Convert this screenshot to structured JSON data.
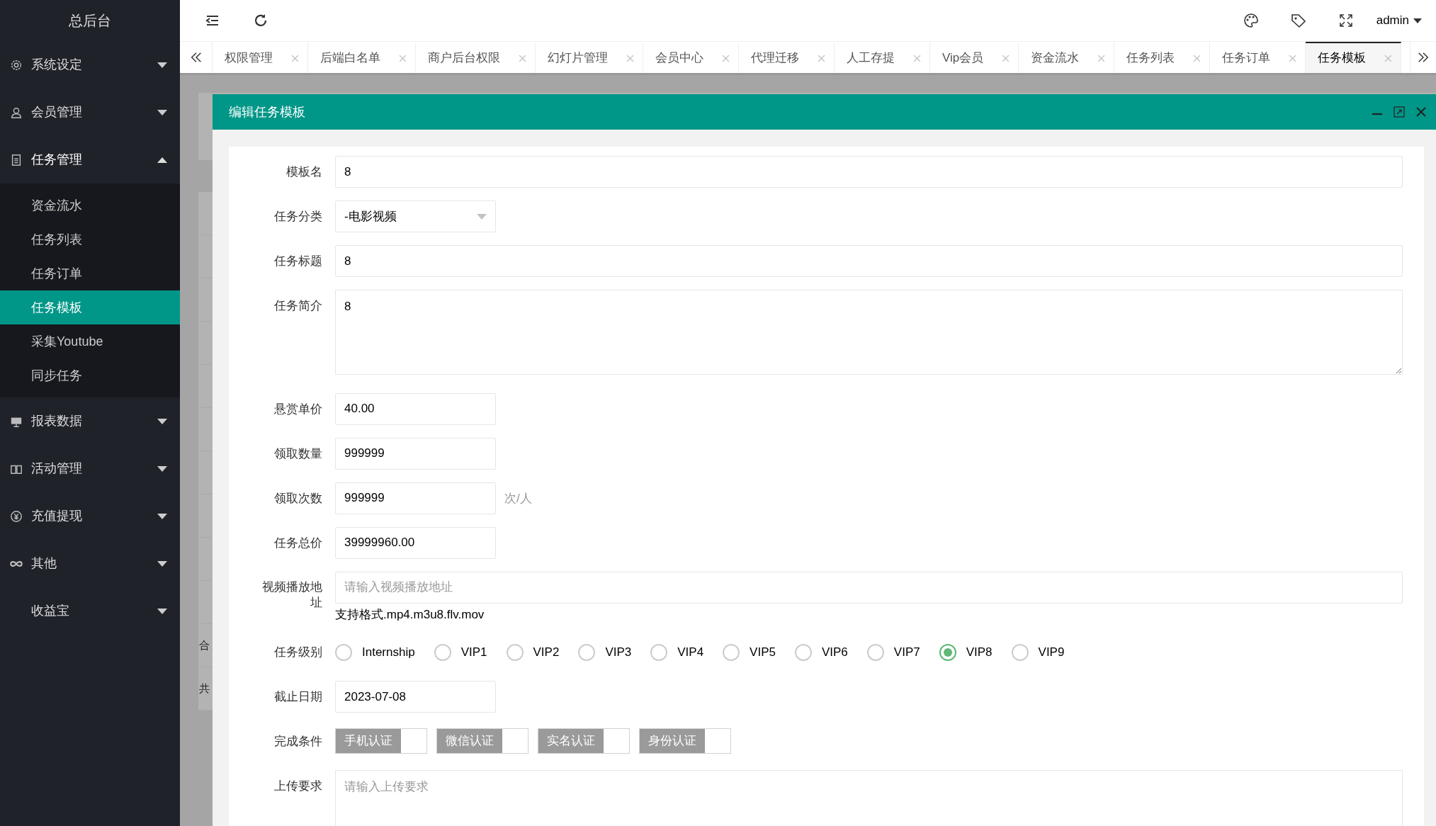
{
  "sidebar": {
    "title": "总后台",
    "menus": [
      {
        "label": "系统设定",
        "expanded": false
      },
      {
        "label": "会员管理",
        "expanded": false
      },
      {
        "label": "任务管理",
        "expanded": true,
        "children": [
          {
            "label": "资金流水",
            "selected": false
          },
          {
            "label": "任务列表",
            "selected": false
          },
          {
            "label": "任务订单",
            "selected": false
          },
          {
            "label": "任务模板",
            "selected": true
          },
          {
            "label": "采集Youtube",
            "selected": false
          },
          {
            "label": "同步任务",
            "selected": false
          }
        ]
      },
      {
        "label": "报表数据",
        "expanded": false
      },
      {
        "label": "活动管理",
        "expanded": false
      },
      {
        "label": "充值提现",
        "expanded": false
      },
      {
        "label": "其他",
        "expanded": false
      },
      {
        "label": "收益宝",
        "expanded": false
      }
    ]
  },
  "header": {
    "user": "admin"
  },
  "tabs": [
    {
      "label": "权限管理",
      "selected": false
    },
    {
      "label": "后端白名单",
      "selected": false
    },
    {
      "label": "商户后台权限",
      "selected": false
    },
    {
      "label": "幻灯片管理",
      "selected": false
    },
    {
      "label": "会员中心",
      "selected": false
    },
    {
      "label": "代理迁移",
      "selected": false
    },
    {
      "label": "人工存提",
      "selected": false
    },
    {
      "label": "Vip会员",
      "selected": false
    },
    {
      "label": "资金流水",
      "selected": false
    },
    {
      "label": "任务列表",
      "selected": false
    },
    {
      "label": "任务订单",
      "selected": false
    },
    {
      "label": "任务模板",
      "selected": true
    }
  ],
  "background_fragments": [
    "合",
    "共"
  ],
  "modal": {
    "title": "编辑任务模板",
    "fields": [
      {
        "kind": "long",
        "label": "模板名",
        "value": "8"
      },
      {
        "kind": "select",
        "label": "任务分类",
        "value": "-电影视频"
      },
      {
        "kind": "long",
        "label": "任务标题",
        "value": "8"
      },
      {
        "kind": "textarea",
        "label": "任务简介",
        "value": "8"
      },
      {
        "kind": "short",
        "label": "悬赏单价",
        "value": "40.00"
      },
      {
        "kind": "short",
        "label": "领取数量",
        "value": "999999"
      },
      {
        "kind": "short",
        "label": "领取次数",
        "value": "999999",
        "suffix": "次/人"
      },
      {
        "kind": "short",
        "label": "任务总价",
        "value": "39999960.00"
      },
      {
        "kind": "long",
        "label": "视频播放地址",
        "placeholder": "请输入视频播放地址",
        "hint": "支持格式.mp4.m3u8.flv.mov"
      },
      {
        "kind": "radio",
        "label": "任务级别",
        "options": [
          {
            "label": "Internship",
            "selected": false
          },
          {
            "label": "VIP1",
            "selected": false
          },
          {
            "label": "VIP2",
            "selected": false
          },
          {
            "label": "VIP3",
            "selected": false
          },
          {
            "label": "VIP4",
            "selected": false
          },
          {
            "label": "VIP5",
            "selected": false
          },
          {
            "label": "VIP6",
            "selected": false
          },
          {
            "label": "VIP7",
            "selected": false
          },
          {
            "label": "VIP8",
            "selected": true
          },
          {
            "label": "VIP9",
            "selected": false
          }
        ]
      },
      {
        "kind": "short",
        "label": "截止日期",
        "value": "2023-07-08"
      },
      {
        "kind": "checks",
        "label": "完成条件",
        "options": [
          {
            "label": "手机认证",
            "checked": false
          },
          {
            "label": "微信认证",
            "checked": false
          },
          {
            "label": "实名认证",
            "checked": false
          },
          {
            "label": "身份认证",
            "checked": false
          }
        ]
      },
      {
        "kind": "textarea",
        "label": "上传要求",
        "placeholder": "请输入上传要求"
      }
    ]
  }
}
